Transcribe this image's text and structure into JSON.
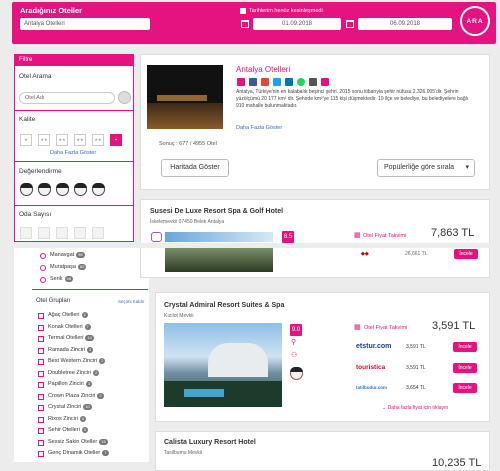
{
  "header": {
    "dest_label": "Aradığınız Oteller",
    "dest_value": "Antalya Otelleri",
    "dates_undecided": "Tarihlerim henüz kesinleşmedi",
    "checkin": "01.09.2018",
    "checkout": "06.09.2018",
    "search_button": "ARA"
  },
  "sidebar": {
    "filter_title": "Filtre",
    "hotel_search_title": "Otel Arama",
    "hotel_name_placeholder": "Otel Adı",
    "quality_title": "Kalite",
    "show_more": "Daha Fazla Göster",
    "rating_title": "Değerlendirme",
    "rooms_title": "Oda Sayısı",
    "locations": [
      {
        "label": "Manavgat",
        "count": "98"
      },
      {
        "label": "Muratpaşa",
        "count": "62"
      },
      {
        "label": "Serik",
        "count": "48"
      }
    ],
    "groups_title": "Otel Grupları",
    "select_all": "Seçimi Kaldır",
    "groups": [
      {
        "label": "Ağaç Otelleri",
        "count": "2"
      },
      {
        "label": "Konak Otelleri",
        "count": "7"
      },
      {
        "label": "Termal Otelleri",
        "count": "14"
      },
      {
        "label": "Ramada Zinciri",
        "count": "3"
      },
      {
        "label": "Best Western Zinciri",
        "count": "2"
      },
      {
        "label": "Doubletree Zinciri",
        "count": "2"
      },
      {
        "label": "Papillon Zinciri",
        "count": "3"
      },
      {
        "label": "Crown Plaza Zinciri",
        "count": "2"
      },
      {
        "label": "Crystal Zinciri",
        "count": "10"
      },
      {
        "label": "Rixos Zinciri",
        "count": "6"
      },
      {
        "label": "Sehir Otelleri",
        "count": "5"
      },
      {
        "label": "Sessiz Sakin Oteller",
        "count": "15"
      },
      {
        "label": "Genç Dinamik Oteller",
        "count": "7"
      }
    ]
  },
  "destination_card": {
    "title": "Antalya Otelleri",
    "description": "Antalya, Türkiye'nin en kalabalık beşinci şehri. 2015 sonu itibarıyla şehir nüfusu 2.326.005'dir. Şehrin yüzölçümü 20 177 km² dir. Şehirde km²'ye 115 kişi düşmektedir. 19 ilçe ve belediye, bu belediyelere bağlı 910 mahalle bulunmaktadır.",
    "more_link": "Daha Fazla Göster",
    "result_count": "Sonuç : 677 / 4955 Otel",
    "map_button": "Haritada Göster",
    "sort_value": "Popülerliğe göre sırala"
  },
  "hotels": [
    {
      "name": "Susesi De Luxe Resort Spa & Golf Hotel",
      "location": "İskelemevkii 07450 Belek Antalya",
      "score": "8.5",
      "price_calendar": "Otel Fiyat Takvimi",
      "price": "7,863 TL",
      "partial_price": "26,661 TL",
      "partial_button": "İncele"
    },
    {
      "name": "Crystal Admiral Resort Suites & Spa",
      "location": "Kızılot Mevkii",
      "score": "9.0",
      "price_calendar": "Otel Fiyat Takvimi",
      "price": "3,591 TL",
      "offers": [
        {
          "site": "etstur.com",
          "price": "3,591 TL",
          "button": "İncele"
        },
        {
          "site": "touristica",
          "price": "3,591 TL",
          "button": "İncele"
        },
        {
          "site": "tatilbudur.com",
          "price": "3,654 TL",
          "button": "İncele"
        }
      ],
      "more_prices": "Daha fazla fiyat için tıklayın"
    },
    {
      "name": "Calista Luxury Resort Hotel",
      "location": "Tasilbumu Mevkii",
      "price": "10,235 TL"
    }
  ],
  "colors": {
    "accent": "#e5137f"
  }
}
